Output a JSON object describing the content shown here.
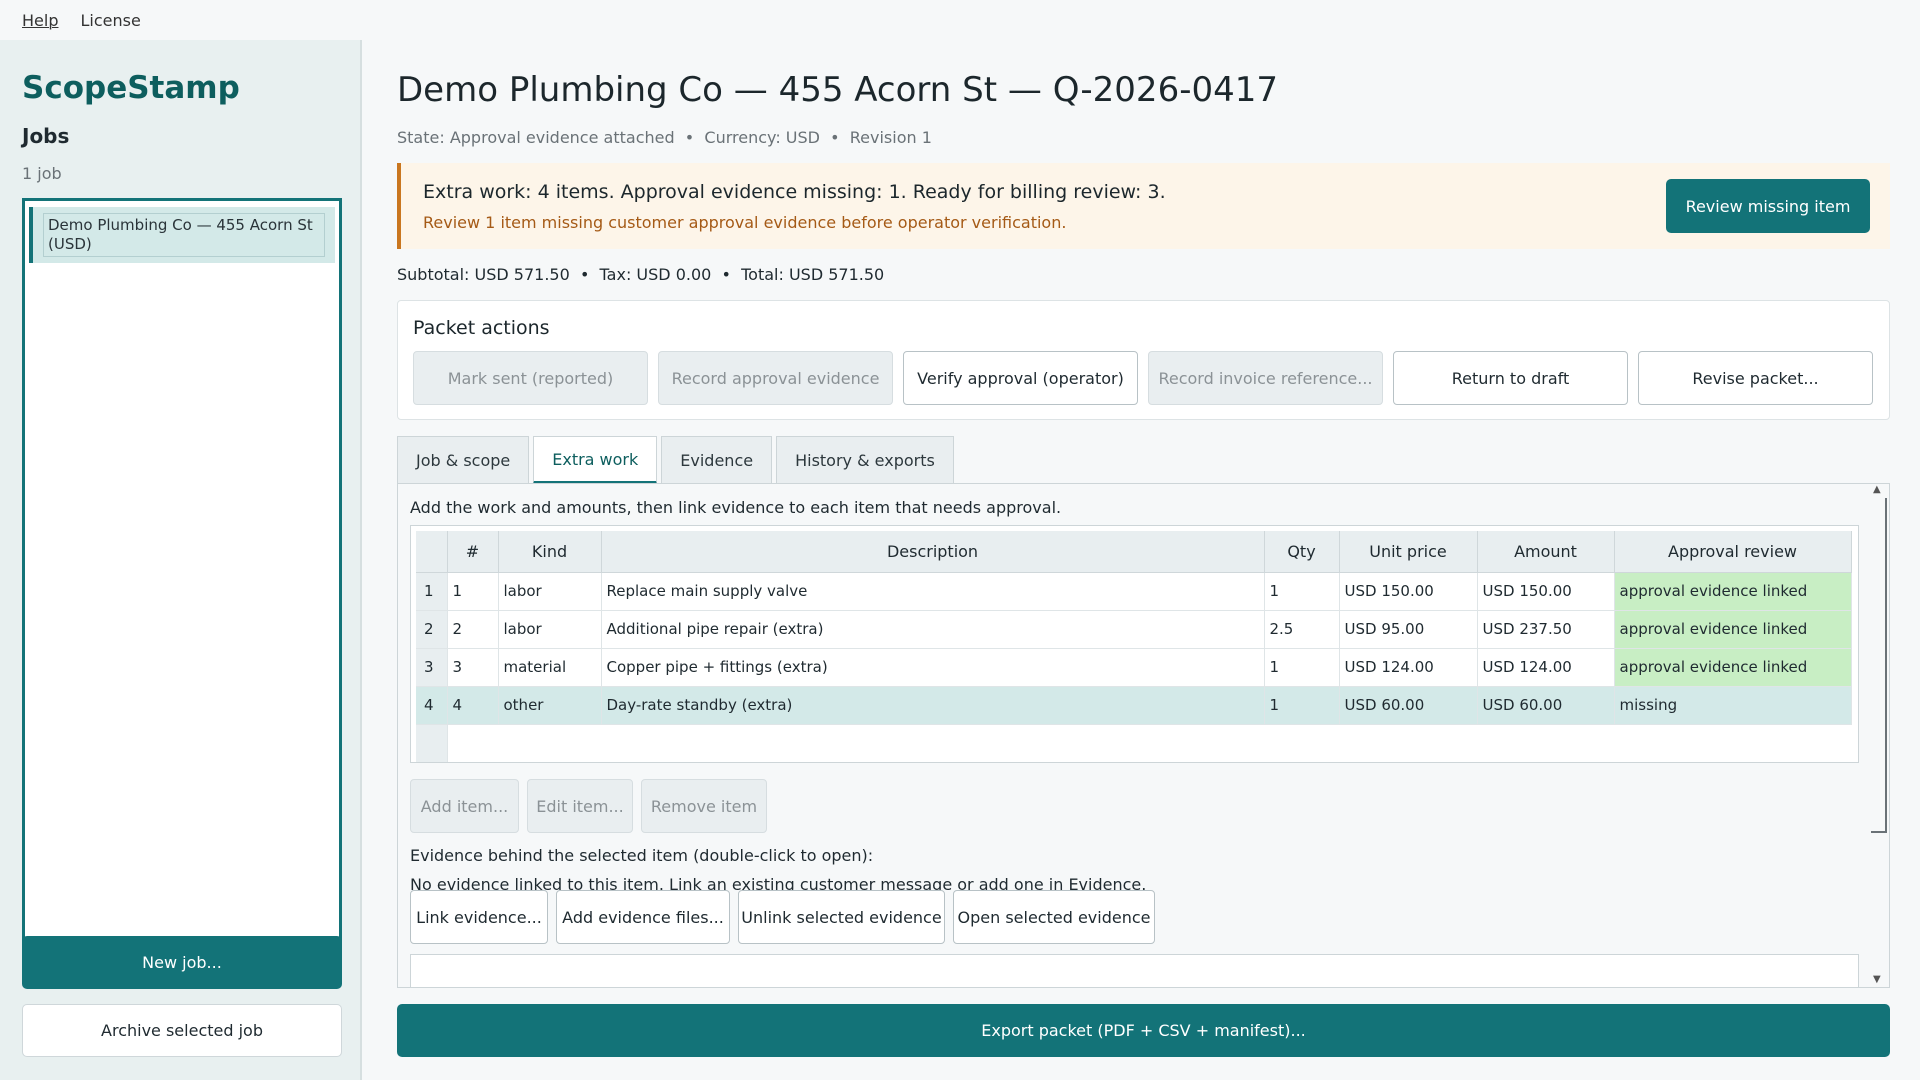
{
  "menubar": {
    "help": "Help",
    "license": "License"
  },
  "sidebar": {
    "brand": "ScopeStamp",
    "jobs_title": "Jobs",
    "jobs_count": "1 job",
    "jobs": [
      {
        "label": "Demo Plumbing Co — 455 Acorn St (USD)"
      }
    ],
    "new_job": "New job...",
    "archive_job": "Archive selected job"
  },
  "header": {
    "title": "Demo Plumbing Co — 455 Acorn St — Q-2026-0417",
    "meta": "State: Approval evidence attached  •  Currency: USD  •  Revision 1"
  },
  "banner": {
    "title": "Extra work: 4 items. Approval evidence missing: 1. Ready for billing review: 3.",
    "subtitle": "Review 1 item missing customer approval evidence before operator verification.",
    "button": "Review missing item"
  },
  "totals": "Subtotal: USD 571.50  •  Tax: USD 0.00  •  Total: USD 571.50",
  "packet": {
    "title": "Packet actions",
    "buttons": [
      {
        "label": "Mark sent (reported)",
        "enabled": false
      },
      {
        "label": "Record approval evidence",
        "enabled": false
      },
      {
        "label": "Verify approval (operator)",
        "enabled": true
      },
      {
        "label": "Record invoice reference...",
        "enabled": false
      },
      {
        "label": "Return to draft",
        "enabled": true
      },
      {
        "label": "Revise packet...",
        "enabled": true
      }
    ]
  },
  "tabs": [
    {
      "label": "Job & scope",
      "active": false
    },
    {
      "label": "Extra work",
      "active": true
    },
    {
      "label": "Evidence",
      "active": false
    },
    {
      "label": "History & exports",
      "active": false
    }
  ],
  "extra_work": {
    "intro": "Add the work and amounts, then link evidence to each item that needs approval.",
    "columns": [
      "#",
      "Kind",
      "Description",
      "Qty",
      "Unit price",
      "Amount",
      "Approval review"
    ],
    "rows": [
      {
        "rownum": "1",
        "num": "1",
        "kind": "labor",
        "description": "Replace main supply valve",
        "qty": "1",
        "unit_price": "USD 150.00",
        "amount": "USD 150.00",
        "approval": "approval evidence linked"
      },
      {
        "rownum": "2",
        "num": "2",
        "kind": "labor",
        "description": "Additional pipe repair (extra)",
        "qty": "2.5",
        "unit_price": "USD 95.00",
        "amount": "USD 237.50",
        "approval": "approval evidence linked"
      },
      {
        "rownum": "3",
        "num": "3",
        "kind": "material",
        "description": "Copper pipe + fittings (extra)",
        "qty": "1",
        "unit_price": "USD 124.00",
        "amount": "USD 124.00",
        "approval": "approval evidence linked"
      },
      {
        "rownum": "4",
        "num": "4",
        "kind": "other",
        "description": "Day-rate standby (extra)",
        "qty": "1",
        "unit_price": "USD 60.00",
        "amount": "USD 60.00",
        "approval": "missing"
      }
    ],
    "item_buttons": {
      "add": "Add item...",
      "edit": "Edit item...",
      "remove": "Remove item"
    },
    "evidence_label": "Evidence behind the selected item (double-click to open):",
    "evidence_note": "No evidence linked to this item. Link an existing customer message or add one in Evidence.",
    "evidence_buttons": {
      "link": "Link evidence...",
      "add_files": "Add evidence files...",
      "unlink": "Unlink selected evidence",
      "open": "Open selected evidence"
    }
  },
  "export_button": "Export packet (PDF + CSV + manifest)...",
  "colors": {
    "accent": "#137378",
    "ok": "#c8eec4",
    "warning_bg": "#fdf5e9",
    "warning_border": "#c9761f"
  }
}
